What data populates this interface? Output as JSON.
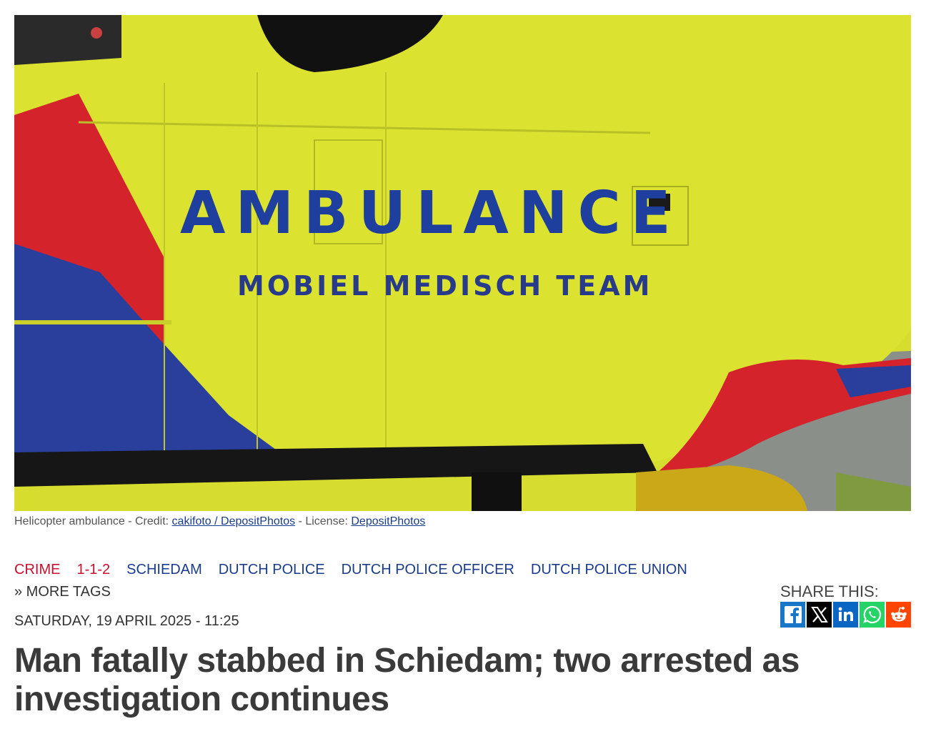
{
  "hero": {
    "main_text": "AMBULANCE",
    "sub_text": "MOBIEL MEDISCH TEAM",
    "colors": {
      "body": "#d8df2e",
      "blue": "#1f3f9e",
      "red": "#d4232b",
      "stripe_blue": "#2a3f9c"
    }
  },
  "caption": {
    "prefix": "Helicopter ambulance - Credit: ",
    "credit_link": "cakifoto / DepositPhotos",
    "license_prefix": " - License: ",
    "license_link": "DepositPhotos"
  },
  "tags": [
    {
      "label": "CRIME",
      "color": "#c8102e"
    },
    {
      "label": "1-1-2",
      "color": "#c8102e"
    },
    {
      "label": "SCHIEDAM",
      "color": "#1a3c8c"
    },
    {
      "label": "DUTCH POLICE",
      "color": "#1a3c8c"
    },
    {
      "label": "DUTCH POLICE OFFICER",
      "color": "#1a3c8c"
    },
    {
      "label": "DUTCH POLICE UNION",
      "color": "#1a3c8c"
    }
  ],
  "more_tags": "» MORE TAGS",
  "date": "SATURDAY, 19 APRIL 2025 - 11:25",
  "share": {
    "label": "SHARE THIS:",
    "buttons": [
      {
        "icon": "facebook-icon",
        "color": "#1877c9"
      },
      {
        "icon": "x-icon",
        "color": "#000000"
      },
      {
        "icon": "linkedin-icon",
        "color": "#0a66c2"
      },
      {
        "icon": "whatsapp-icon",
        "color": "#25d366"
      },
      {
        "icon": "reddit-icon",
        "color": "#ff4500"
      }
    ]
  },
  "headline": "Man fatally stabbed in Schiedam; two arrested as investigation continues"
}
